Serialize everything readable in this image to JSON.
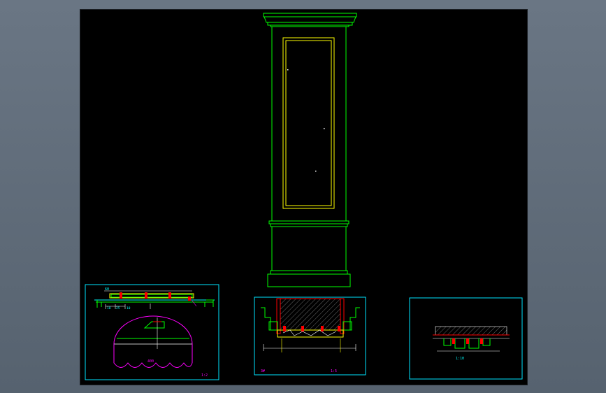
{
  "drawing": {
    "background": "#000000",
    "colors": {
      "green": "#00ff00",
      "yellow": "#ffff00",
      "cyan": "#00ffff",
      "red": "#ff0000",
      "magenta": "#ff00ff",
      "white": "#ffffff",
      "frame": "#00e5ff"
    },
    "labels": {
      "d1_top": "60",
      "d1_a": "10",
      "d1_b": "25",
      "d1_c": "10",
      "d1_arc": "400",
      "d1_caption": "1:2",
      "d2_caption_left": "3#",
      "d2_caption_right": "1:5",
      "d3_caption": "1:10"
    }
  }
}
